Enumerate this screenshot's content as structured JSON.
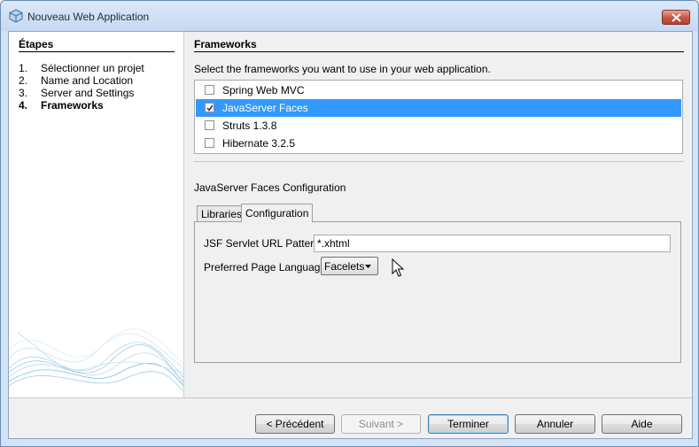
{
  "window": {
    "title": "Nouveau Web Application",
    "icon": "netbeans-cube-icon"
  },
  "steps": {
    "title": "Étapes",
    "items": [
      {
        "num": "1.",
        "label": "Sélectionner un projet",
        "current": false
      },
      {
        "num": "2.",
        "label": "Name and Location",
        "current": false
      },
      {
        "num": "3.",
        "label": "Server and Settings",
        "current": false
      },
      {
        "num": "4.",
        "label": "Frameworks",
        "current": true
      }
    ]
  },
  "content": {
    "title": "Frameworks",
    "instruction": "Select the frameworks you want to use in your web application.",
    "frameworks": [
      {
        "label": "Spring Web MVC",
        "checked": false,
        "selected": false
      },
      {
        "label": "JavaServer Faces",
        "checked": true,
        "selected": true
      },
      {
        "label": "Struts 1.3.8",
        "checked": false,
        "selected": false
      },
      {
        "label": "Hibernate 3.2.5",
        "checked": false,
        "selected": false
      }
    ],
    "config_title": "JavaServer Faces Configuration",
    "tabs": [
      {
        "label": "Libraries",
        "active": false
      },
      {
        "label": "Configuration",
        "active": true
      }
    ],
    "url_pattern_label": "JSF Servlet URL Pattern:",
    "url_pattern_value": "*.xhtml",
    "page_language_label": "Preferred Page Language:",
    "page_language_value": "Facelets"
  },
  "buttons": {
    "previous": "< Précédent",
    "next": "Suivant >",
    "finish": "Terminer",
    "cancel": "Annuler",
    "help": "Aide"
  },
  "colors": {
    "selection": "#3399ff",
    "titlebar": "#c6d9f1",
    "close_button": "#c75a46"
  }
}
